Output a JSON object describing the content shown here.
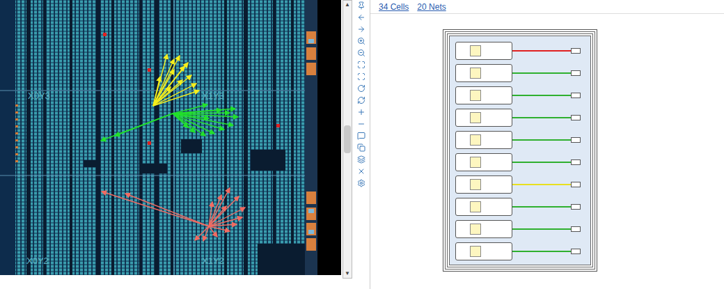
{
  "device": {
    "regions": [
      "X0Y3",
      "X1Y3",
      "X0Y2",
      "X1Y2"
    ],
    "nets": [
      {
        "color": "#f5ee1c"
      },
      {
        "color": "#22e02a"
      },
      {
        "color": "#f26b62"
      }
    ]
  },
  "schematic": {
    "header": {
      "cells": "34 Cells",
      "nets": "20 Nets"
    },
    "cells": [
      {
        "color": "#e02020"
      },
      {
        "color": "#2fb02f"
      },
      {
        "color": "#2fb02f"
      },
      {
        "color": "#2fb02f"
      },
      {
        "color": "#2fb02f"
      },
      {
        "color": "#2fb02f"
      },
      {
        "color": "#e8e020"
      },
      {
        "color": "#2fb02f"
      },
      {
        "color": "#2fb02f"
      },
      {
        "color": "#2fb02f"
      }
    ]
  }
}
